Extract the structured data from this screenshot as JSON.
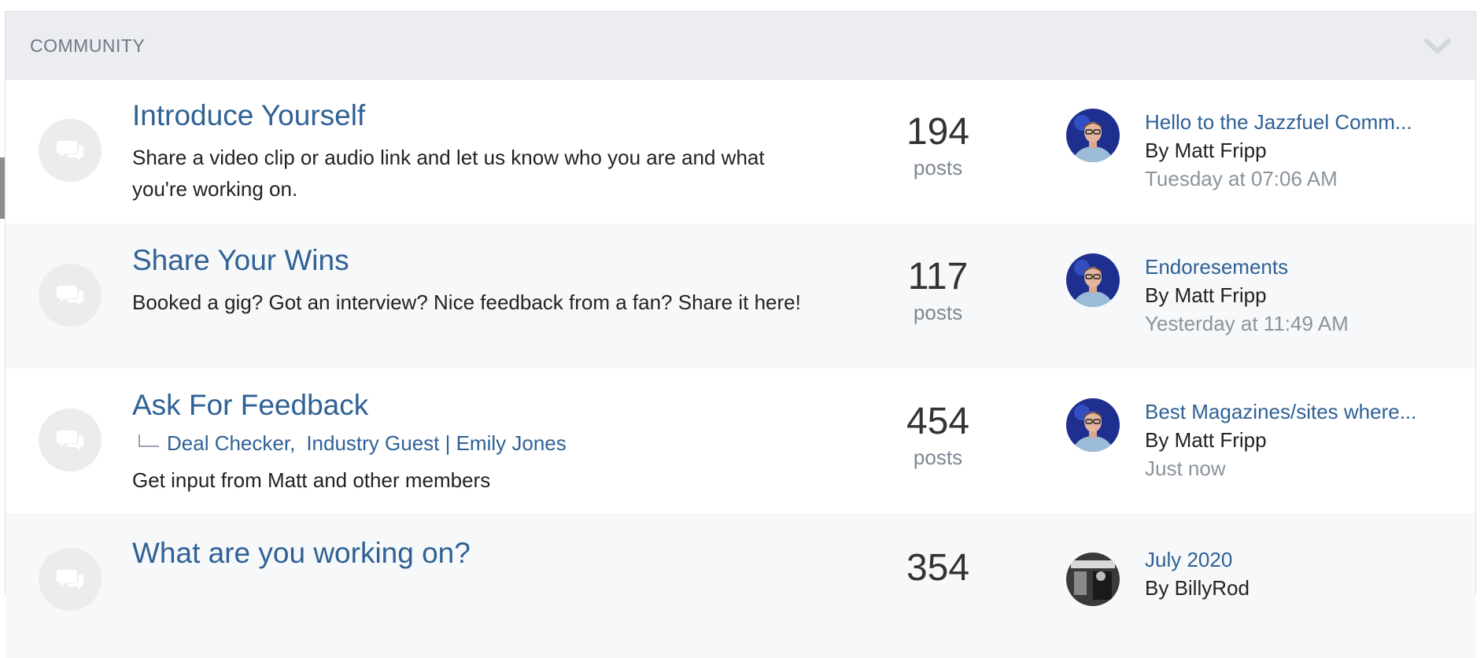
{
  "category": {
    "title": "COMMUNITY"
  },
  "forums": [
    {
      "title": "Introduce Yourself",
      "description": "Share a video clip or audio link and let us know who you are and what you're working on.",
      "count": "194",
      "count_label": "posts",
      "last_post": {
        "title": "Hello to the Jazzfuel Comm...",
        "author": "By Matt Fripp",
        "time": "Tuesday at 07:06 AM"
      }
    },
    {
      "title": "Share Your Wins",
      "description": "Booked a gig? Got an interview? Nice feedback from a fan? Share it here!",
      "count": "117",
      "count_label": "posts",
      "last_post": {
        "title": "Endoresements",
        "author": "By Matt Fripp",
        "time": "Yesterday at 11:49 AM"
      }
    },
    {
      "title": "Ask For Feedback",
      "subforums": [
        "Deal Checker,",
        "Industry Guest | Emily Jones"
      ],
      "description": "Get input from Matt and other members",
      "count": "454",
      "count_label": "posts",
      "last_post": {
        "title": "Best Magazines/sites where...",
        "author": "By Matt Fripp",
        "time": "Just now"
      }
    },
    {
      "title": "What are you working on?",
      "count": "354",
      "last_post": {
        "title": "July 2020",
        "author": "By BillyRod"
      }
    }
  ],
  "icons": {
    "collapse": "chevron-down-icon",
    "forum": "chat-bubbles-icon"
  },
  "colors": {
    "link": "#2f6195",
    "header_bg": "#ebedf0",
    "alt_row_bg": "#f7f8f9"
  }
}
